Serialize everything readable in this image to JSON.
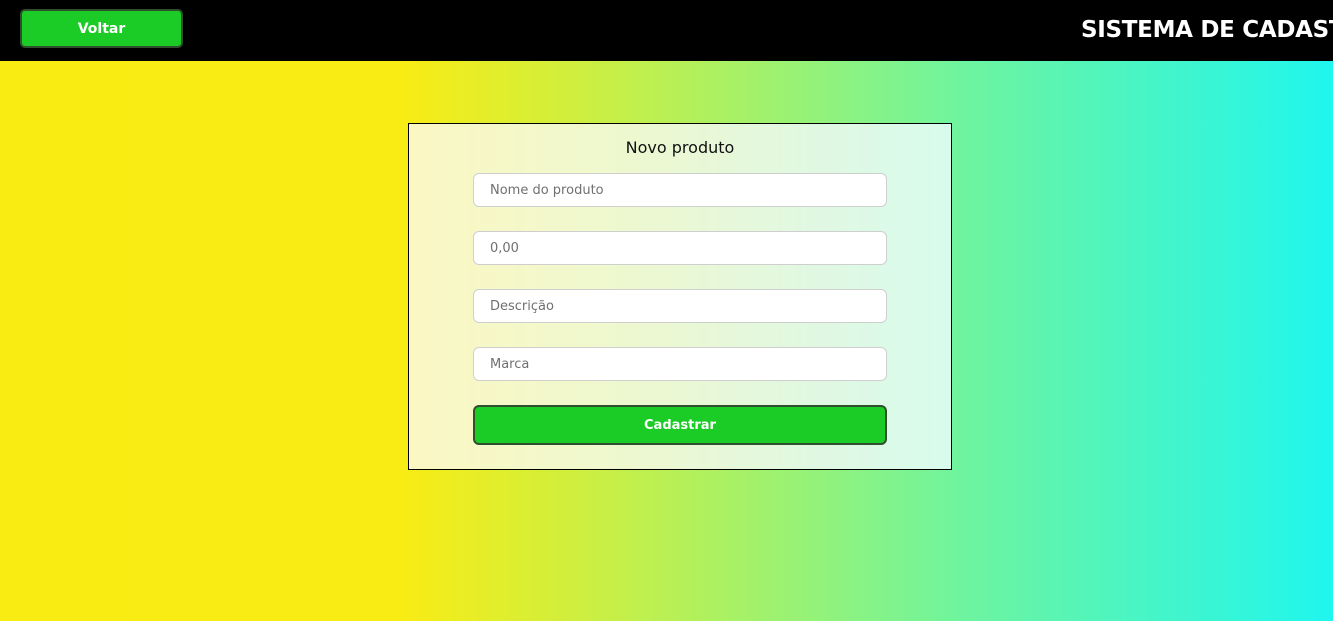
{
  "header": {
    "back_label": "Voltar",
    "title": "SISTEMA DE CADASTRO"
  },
  "form": {
    "title": "Novo produto",
    "fields": [
      {
        "placeholder": "Nome do produto",
        "value": ""
      },
      {
        "placeholder": "0,00",
        "value": ""
      },
      {
        "placeholder": "Descrição",
        "value": ""
      },
      {
        "placeholder": "Marca",
        "value": ""
      }
    ],
    "submit_label": "Cadastrar"
  },
  "colors": {
    "header_bg": "#000000",
    "button_green": "#1bcb26",
    "gradient_start": "#f8ec13",
    "gradient_end": "#1ff6ee"
  }
}
